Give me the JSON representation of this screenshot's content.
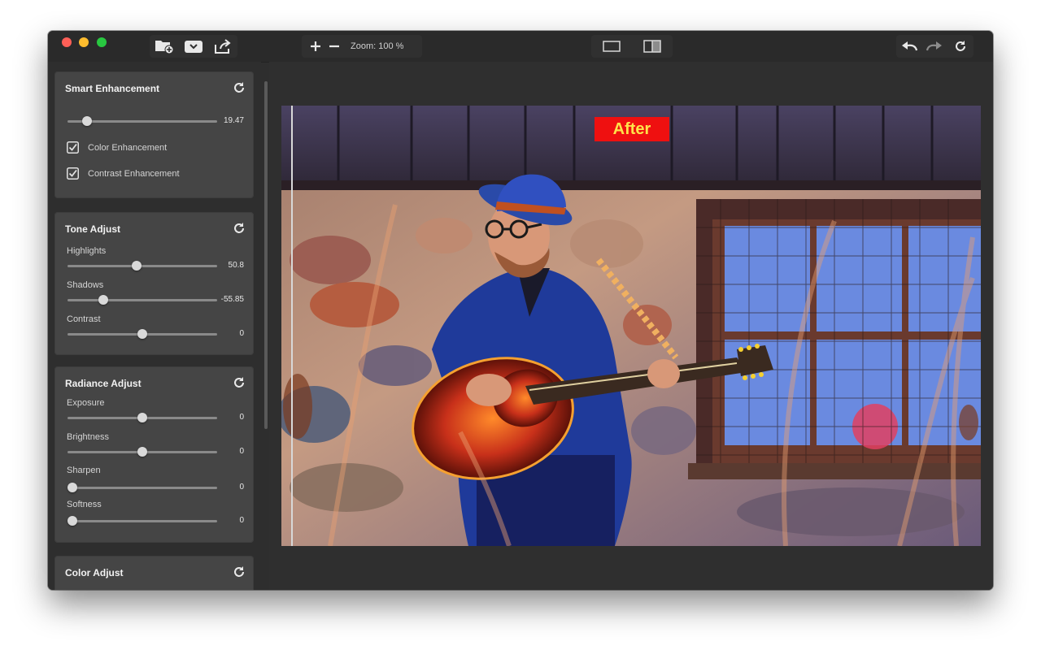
{
  "toolbar": {
    "zoom_label": "Zoom: 100 %"
  },
  "panels": {
    "smart": {
      "title": "Smart Enhancement",
      "slider": {
        "value": "19.47",
        "level": 0.13
      },
      "checks": [
        {
          "label": "Color Enhancement",
          "checked": true
        },
        {
          "label": "Contrast Enhancement",
          "checked": true
        }
      ]
    },
    "tone": {
      "title": "Tone Adjust",
      "sliders": [
        {
          "label": "Highlights",
          "value": "50.8",
          "level": 0.46
        },
        {
          "label": "Shadows",
          "value": "-55.85",
          "level": 0.24
        },
        {
          "label": "Contrast",
          "value": "0",
          "level": 0.5
        }
      ]
    },
    "radiance": {
      "title": "Radiance Adjust",
      "sliders": [
        {
          "label": "Exposure",
          "value": "0",
          "level": 0.5
        },
        {
          "label": "Brightness",
          "value": "0",
          "level": 0.5
        },
        {
          "label": "Sharpen",
          "value": "0",
          "level": 0.03
        },
        {
          "label": "Softness",
          "value": "0",
          "level": 0.03
        }
      ]
    },
    "color": {
      "title": "Color Adjust"
    }
  },
  "image": {
    "badge": "After"
  },
  "colors": {
    "window_bg": "#2e2e2e",
    "panel_bg": "#454545",
    "badge_bg": "#ef1010",
    "badge_text": "#ffe24a"
  }
}
